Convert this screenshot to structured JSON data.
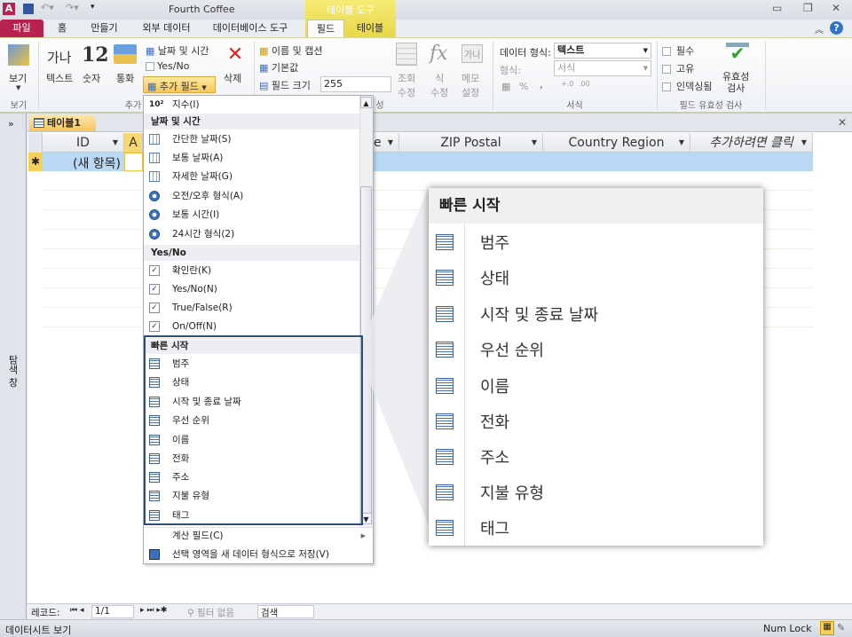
{
  "window": {
    "title": "Fourth Coffee",
    "context_tab_group": "테이블 도구"
  },
  "ribbon_tabs": [
    "파일",
    "홈",
    "만들기",
    "외부 데이터",
    "데이터베이스 도구",
    "필드",
    "테이블"
  ],
  "ribbon": {
    "view": {
      "label": "보기",
      "group": "보기"
    },
    "add_delete": {
      "text": "텍스트",
      "number": "숫자",
      "currency": "통화",
      "date_time": "날짜 및 시간",
      "yes_no": "Yes/No",
      "more_fields": "추가 필드",
      "delete": "삭제",
      "group": "추가",
      "text_icon": "가나",
      "number_icon": "12"
    },
    "properties": {
      "name_caption": "이름 및 캡션",
      "default_value": "기본값",
      "field_size_label": "필드 크기",
      "field_size_value": "255",
      "lookup": "조회\n수정",
      "expression": "식\n수정",
      "memo": "메모\n설정",
      "memo_icon": "가나",
      "group_tail": "성"
    },
    "formatting": {
      "data_type_label": "데이터 형식:",
      "data_type_value": "텍스트",
      "format_label": "형식:",
      "format_value": "서식",
      "percent": "%",
      "comma": ",",
      "group": "서식"
    },
    "validation": {
      "required": "필수",
      "unique": "고유",
      "indexed": "인덱싱됨",
      "validation": "유효성\n검사",
      "group": "필드 유효성 검사"
    }
  },
  "nav_pane": {
    "label": "탐색 창"
  },
  "document": {
    "tab": "테이블1",
    "columns": [
      "ID",
      "A",
      "e",
      "ZIP Postal",
      "Country Region",
      "추가하려면 클릭"
    ],
    "new_row": "(새 항목)"
  },
  "menu": {
    "top_item": "지수(I)",
    "sections": [
      {
        "header": "날짜 및 시간",
        "items": [
          "간단한 날짜(S)",
          "보통 날짜(A)",
          "자세한 날짜(G)",
          "오전/오후 형식(A)",
          "보통 시간(I)",
          "24시간 형식(2)"
        ]
      },
      {
        "header": "Yes/No",
        "items": [
          "확인란(K)",
          "Yes/No(N)",
          "True/False(R)",
          "On/Off(N)"
        ]
      },
      {
        "header": "빠른 시작",
        "items": [
          "범주",
          "상태",
          "시작 및 종료 날짜",
          "우선 순위",
          "이름",
          "전화",
          "주소",
          "지불 유형",
          "태그"
        ]
      }
    ],
    "calculated": "계산 필드(C)",
    "save_selection": "선택 영역을 새 데이터 형식으로 저장(V)"
  },
  "callout": {
    "header": "빠른 시작",
    "items": [
      "범주",
      "상태",
      "시작 및 종료 날짜",
      "우선 순위",
      "이름",
      "전화",
      "주소",
      "지불 유형",
      "태그"
    ]
  },
  "record_nav": {
    "label": "레코드:",
    "position": "1/1",
    "filter": "필터 없음",
    "search": "검색"
  },
  "status_bar": {
    "left": "데이터시트 보기",
    "num_lock": "Num Lock"
  },
  "colors": {
    "file_tab": "#b7224f",
    "context_tab": "#e8d84a",
    "new_row": "#b9d8f4",
    "doc_tab": "#f7c35c"
  }
}
